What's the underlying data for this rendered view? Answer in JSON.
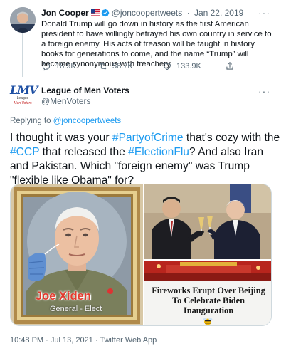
{
  "parent_tweet": {
    "name": "Jon Cooper",
    "handle": "@joncoopertweets",
    "separator": "·",
    "date": "Jan 22, 2019",
    "text": "Donald Trump will go down in history as the first American president to have willingly betrayed his own country in service to a foreign enemy. His acts of treason will be taught in history books for generations to come, and the name “Trump” will become synonymous with treachery.",
    "replies": "18.9K",
    "retweets": "58.7K",
    "likes": "133.9K"
  },
  "main_tweet": {
    "name": "League of Men Voters",
    "handle": "@MenVoters",
    "avatar_text": "LMV",
    "avatar_sub1": "League",
    "avatar_sub2": "Men Voters",
    "reply_prefix": "Replying to",
    "reply_handle": "@joncoopertweets",
    "text": {
      "t1": "I thought it was your ",
      "h1": "#PartyofCrime",
      "t2": " that's cozy with the ",
      "h2": "#CCP",
      "t3": " that released the ",
      "h3": "#ElectionFlu",
      "t4": "?  And also Iran and Pakistan.  Which \"foreign enemy\" was Trump \"flexible like Obama\" for?"
    },
    "media": {
      "left_caption_title": "Joe Xiden",
      "left_caption_sub": "General - Elect",
      "news_headline": "Fireworks Erupt Over Beijing To Celebrate Biden Inauguration"
    },
    "timestamp": "10:48 PM · Jul 13, 2021 · Twitter Web App"
  },
  "colors": {
    "link": "#1d9bf0",
    "muted": "#536471",
    "text": "#0f1419",
    "caption_red": "#e23b2e"
  },
  "icons": [
    "reply-icon",
    "retweet-icon",
    "like-icon",
    "share-icon",
    "verified-icon",
    "us-flag-icon",
    "more-icon"
  ]
}
